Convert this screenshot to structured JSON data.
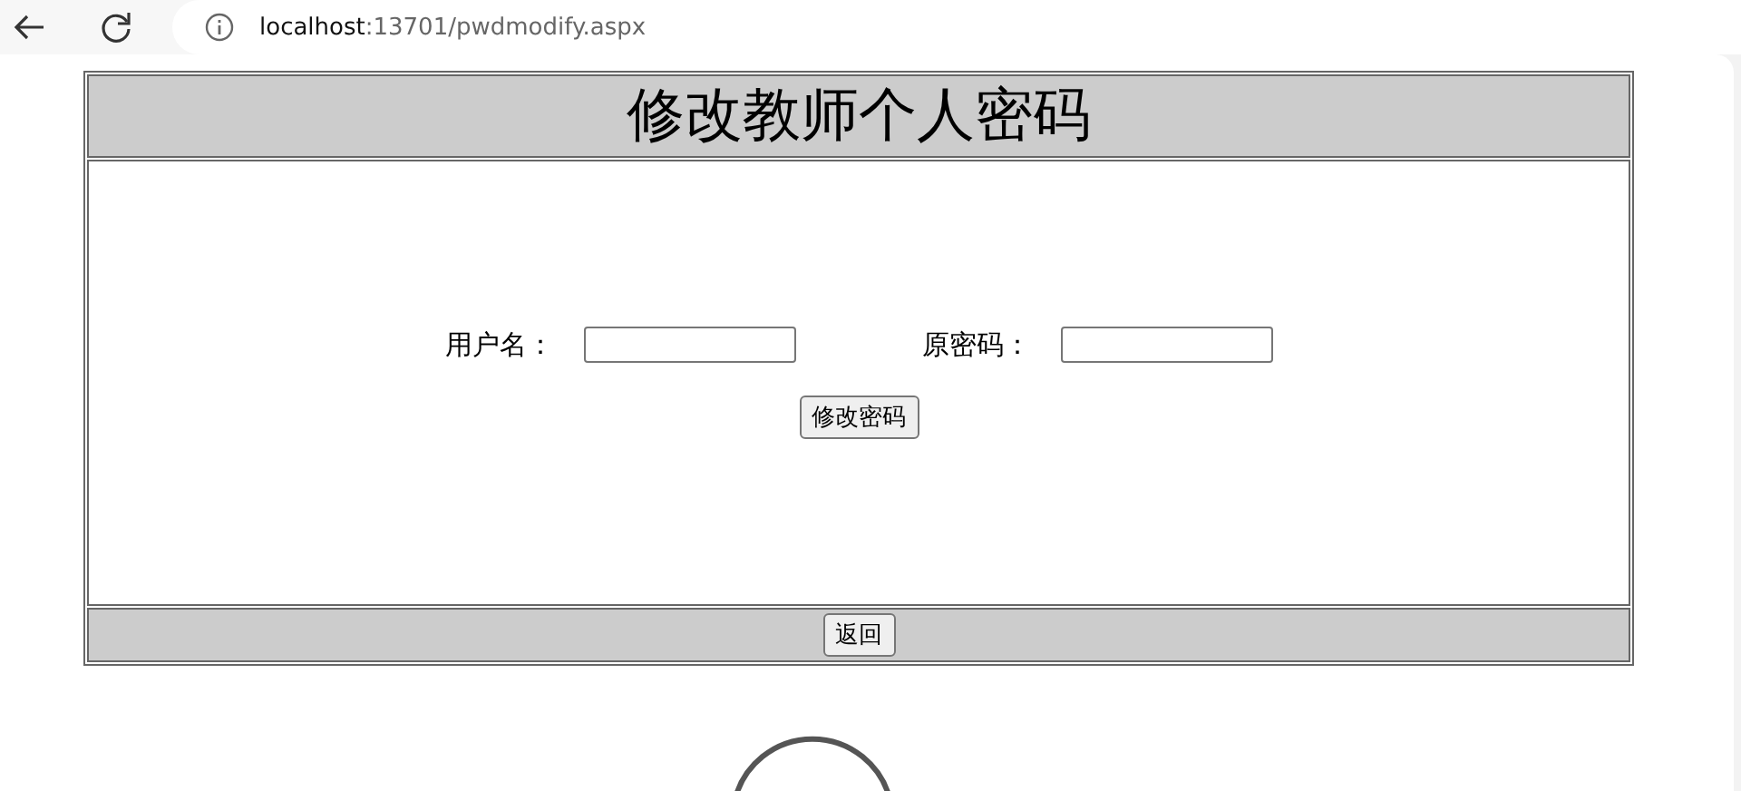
{
  "browser": {
    "url_host": "localhost",
    "url_path": ":13701/pwdmodify.aspx"
  },
  "page": {
    "title": "修改教师个人密码",
    "fields": [
      {
        "label": "用户名："
      },
      {
        "label": "原密码："
      }
    ],
    "submit_button": "修改密码",
    "back_button": "返回"
  }
}
